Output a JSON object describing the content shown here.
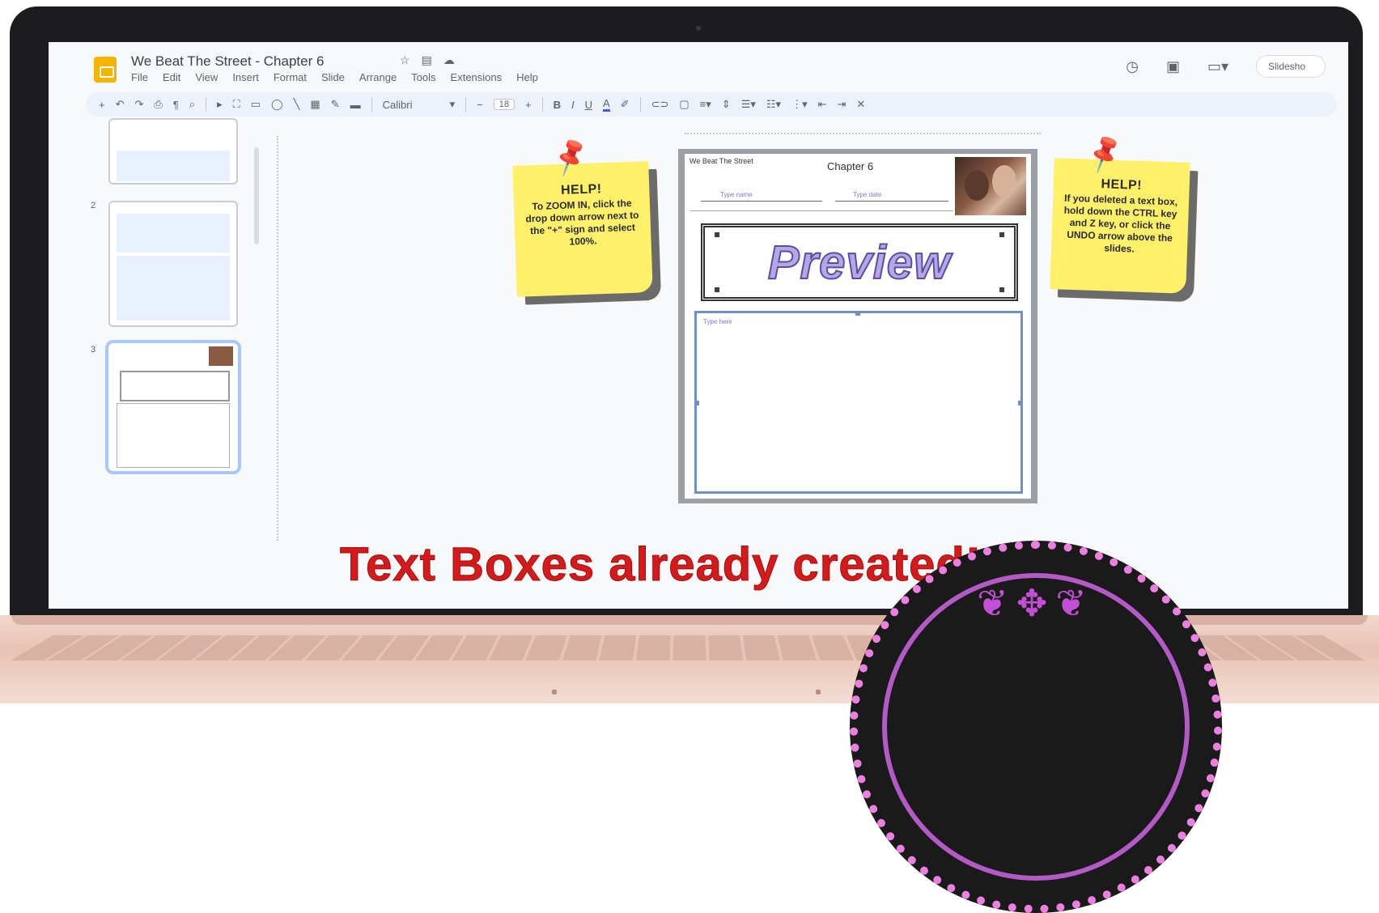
{
  "document": {
    "title": "We Beat The Street - Chapter 6",
    "title_icons": [
      "☆",
      "▤",
      "☁"
    ]
  },
  "menu": [
    "File",
    "Edit",
    "View",
    "Insert",
    "Format",
    "Slide",
    "Arrange",
    "Tools",
    "Extensions",
    "Help"
  ],
  "header_right": {
    "history_icon": "history-icon",
    "comment_icon": "comment-icon",
    "meet_icon": "camera-icon",
    "slideshow_label": "Slidesho"
  },
  "toolbar": {
    "font": "Calibri",
    "font_size": "18",
    "icons": [
      "+",
      "↶",
      "↷",
      "⎙",
      "¶",
      "⌕",
      "▸",
      "⛶",
      "▭",
      "◯",
      "╲",
      "▦",
      "✎",
      "▬"
    ]
  },
  "filmstrip": {
    "numbers": [
      "2",
      "3"
    ],
    "selected_index": 3
  },
  "slide": {
    "worksheet_label": "We Beat The Street",
    "chapter": "Chapter 6",
    "name_placeholder": "Type name",
    "date_placeholder": "Type date",
    "preview_text": "Preview",
    "textbox_placeholder": "Type here"
  },
  "notes": {
    "left": {
      "heading": "HELP!",
      "body": "To ZOOM IN, click the drop down arrow next to the \"+\" sign and select 100%."
    },
    "right": {
      "heading": "HELP!",
      "body": "If you deleted a text box, hold down the CTRL key and Z key, or click the UNDO arrow above the slides."
    }
  },
  "caption": "Text Boxes already created!",
  "colors": {
    "caption": "#d41a1a",
    "note": "#fff06a",
    "pin": "#d0101a",
    "badge_ring": "#ec7fe0",
    "slides_logo": "#f4b400"
  }
}
